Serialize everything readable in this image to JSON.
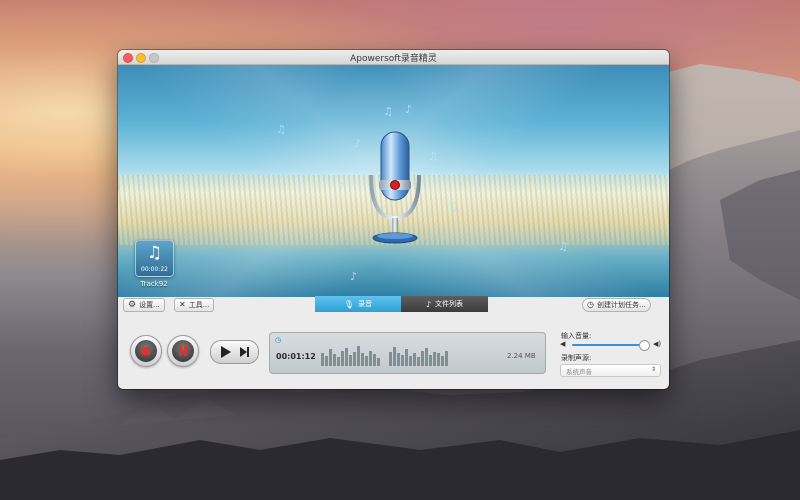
{
  "window": {
    "title": "Apowersoft录音精灵"
  },
  "banner": {
    "track": {
      "icon": "music-note-icon",
      "duration": "00:00:22",
      "name": "Track92"
    }
  },
  "toolbar": {
    "settings_label": "设置...",
    "tools_label": "工具...",
    "schedule_label": "创建计划任务..."
  },
  "tabs": [
    {
      "label": "录音",
      "icon": "microphone-icon",
      "active": true
    },
    {
      "label": "文件列表",
      "icon": "music-note-icon",
      "active": false
    }
  ],
  "status": {
    "elapsed": "00:01:12",
    "file_size": "2.24 MB",
    "levels": [
      0.6,
      0.45,
      0.75,
      0.55,
      0.4,
      0.7,
      0.8,
      0.5,
      0.65,
      0.9,
      0.6,
      0.45,
      0.7,
      0.55,
      0.35,
      0.65,
      0.85,
      0.6,
      0.5,
      0.75,
      0.45,
      0.6,
      0.4,
      0.7,
      0.8,
      0.5,
      0.65,
      0.6,
      0.45,
      0.7
    ]
  },
  "audio": {
    "input_volume_label": "输入音量:",
    "input_volume": 0.9,
    "source_label": "录制声源:",
    "source_value": "系统声音"
  },
  "colors": {
    "accent": "#2f9fd3",
    "close": "#fc5f57",
    "minimize": "#fdbc2e"
  }
}
